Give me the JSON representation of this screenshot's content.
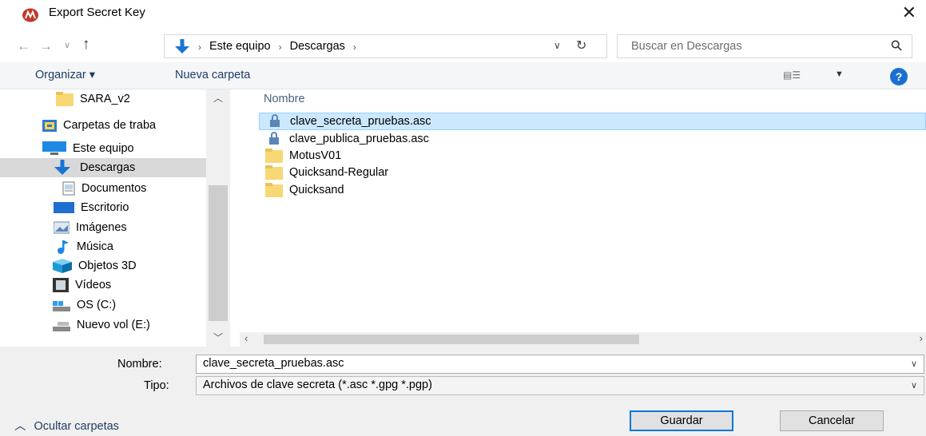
{
  "window": {
    "title": "Export Secret Key",
    "close_icon": "close-icon"
  },
  "nav": {
    "back_icon": "arrow-left-icon",
    "forward_icon": "arrow-right-icon",
    "recent_icon": "chevron-down-icon",
    "up_icon": "arrow-up-icon",
    "breadcrumb": [
      "Este equipo",
      "Descargas"
    ],
    "search_placeholder": "Buscar en Descargas"
  },
  "toolbar": {
    "organize_label": "Organizar ▾",
    "new_folder_label": "Nueva carpeta",
    "help_label": "?"
  },
  "sidebar": {
    "items": [
      {
        "label": "SARA_v2",
        "icon": "folder-icon"
      },
      {
        "label": "Carpetas de traba",
        "icon": "work-folders-icon"
      },
      {
        "label": "Este equipo",
        "icon": "computer-icon"
      },
      {
        "label": "Descargas",
        "icon": "download-icon"
      },
      {
        "label": "Documentos",
        "icon": "document-icon"
      },
      {
        "label": "Escritorio",
        "icon": "desktop-icon"
      },
      {
        "label": "Imágenes",
        "icon": "pictures-icon"
      },
      {
        "label": "Música",
        "icon": "music-icon"
      },
      {
        "label": "Objetos 3D",
        "icon": "cube-icon"
      },
      {
        "label": "Vídeos",
        "icon": "video-icon"
      },
      {
        "label": "OS (C:)",
        "icon": "drive-icon"
      },
      {
        "label": "Nuevo vol (E:)",
        "icon": "drive-icon"
      }
    ]
  },
  "content": {
    "column_header": "Nombre",
    "files": [
      {
        "name": "clave_secreta_pruebas.asc",
        "type": "key-file",
        "selected": true
      },
      {
        "name": "clave_publica_pruebas.asc",
        "type": "key-file",
        "selected": false
      },
      {
        "name": "MotusV01",
        "type": "folder",
        "selected": false
      },
      {
        "name": "Quicksand-Regular",
        "type": "folder",
        "selected": false
      },
      {
        "name": "Quicksand",
        "type": "folder",
        "selected": false
      }
    ]
  },
  "form": {
    "name_label": "Nombre:",
    "name_value": "clave_secreta_pruebas.asc",
    "type_label": "Tipo:",
    "type_value": "Archivos de clave secreta (*.asc *.gpg *.pgp)"
  },
  "actions": {
    "hide_folders_label": "Ocultar carpetas",
    "save_label": "Guardar",
    "cancel_label": "Cancelar"
  },
  "colors": {
    "selection": "#cce8ff",
    "selection_border": "#99d1ff",
    "accent": "#0078d7",
    "folder": "#f8d775",
    "footer_bg": "#f0f0f0"
  }
}
